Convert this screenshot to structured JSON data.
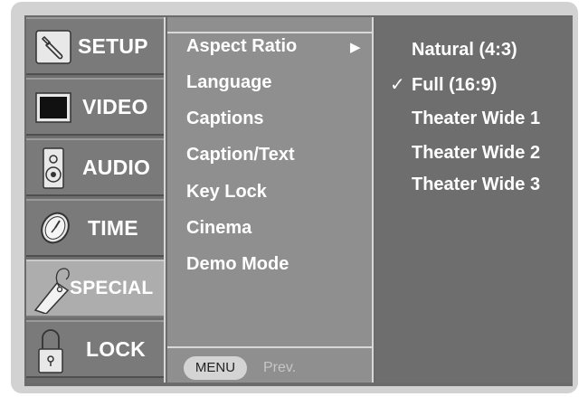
{
  "categories": [
    {
      "label": "SETUP",
      "icon": "wrench-icon"
    },
    {
      "label": "VIDEO",
      "icon": "monitor-icon"
    },
    {
      "label": "AUDIO",
      "icon": "speaker-icon"
    },
    {
      "label": "TIME",
      "icon": "clock-icon"
    },
    {
      "label": "SPECIAL",
      "icon": "tag-icon"
    },
    {
      "label": "LOCK",
      "icon": "padlock-icon"
    }
  ],
  "active_category": "SPECIAL",
  "menu": {
    "items": [
      "Aspect Ratio",
      "Language",
      "Captions",
      "Caption/Text",
      "Key Lock",
      "Cinema",
      "Demo Mode"
    ],
    "selected": "Aspect Ratio",
    "submenu_arrow": "▶",
    "footer": {
      "button": "MENU",
      "hint": "Prev."
    }
  },
  "options": {
    "items": [
      "Natural (4:3)",
      "Full (16:9)",
      "Theater Wide 1",
      "Theater Wide 2",
      "Theater Wide 3"
    ],
    "checked": "Full (16:9)",
    "check_mark": "✓"
  }
}
